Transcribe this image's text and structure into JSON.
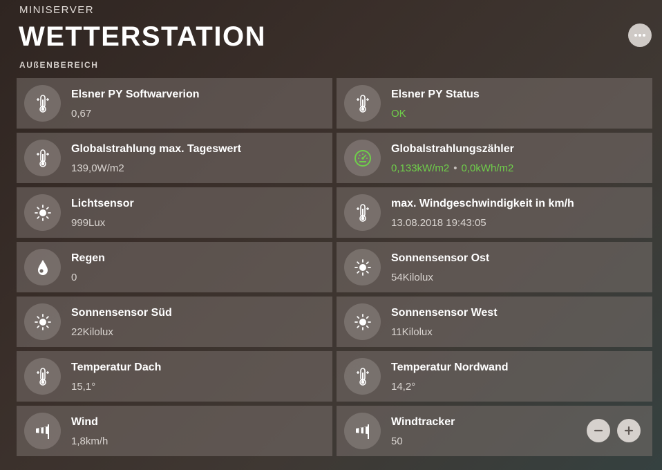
{
  "header": {
    "app_name": "MINISERVER",
    "title": "WETTERSTATION",
    "subtitle": "AUßENBEREICH",
    "more_icon": "more-dots-icon"
  },
  "colors": {
    "accent_green": "#6fcf4a",
    "tile_background": "#78706c",
    "text_primary": "#ffffff",
    "text_secondary": "#d9d4d0"
  },
  "tiles": [
    {
      "title": "Elsner PY Softwarverion",
      "value": "0,67",
      "icon": "thermometer-icon"
    },
    {
      "title": "Elsner PY Status",
      "value": "OK",
      "icon": "thermometer-icon",
      "value_color": "green"
    },
    {
      "title": "Globalstrahlung max. Tageswert",
      "value": "139,0W/m2",
      "icon": "thermometer-icon"
    },
    {
      "title": "Globalstrahlungszähler",
      "value": "0,133kW/m2",
      "value2": "0,0kWh/m2",
      "separator": "•",
      "icon": "gauge-icon",
      "value_color": "green"
    },
    {
      "title": "Lichtsensor",
      "value": "999Lux",
      "icon": "sun-icon"
    },
    {
      "title": "max. Windgeschwindigkeit in km/h",
      "value": "13.08.2018 19:43:05",
      "icon": "thermometer-icon"
    },
    {
      "title": "Regen",
      "value": "0",
      "icon": "raindrop-icon"
    },
    {
      "title": "Sonnensensor Ost",
      "value": "54Kilolux",
      "icon": "sun-icon"
    },
    {
      "title": "Sonnensensor Süd",
      "value": "22Kilolux",
      "icon": "sun-icon"
    },
    {
      "title": "Sonnensensor West",
      "value": "11Kilolux",
      "icon": "sun-icon"
    },
    {
      "title": "Temperatur Dach",
      "value": "15,1°",
      "icon": "thermometer-icon"
    },
    {
      "title": "Temperatur Nordwand",
      "value": "14,2°",
      "icon": "thermometer-icon"
    },
    {
      "title": "Wind",
      "value": "1,8km/h",
      "icon": "windsock-icon"
    },
    {
      "title": "Windtracker",
      "value": "50",
      "icon": "windsock-icon",
      "stepper": {
        "minus_icon": "minus-icon",
        "plus_icon": "plus-icon"
      }
    }
  ]
}
